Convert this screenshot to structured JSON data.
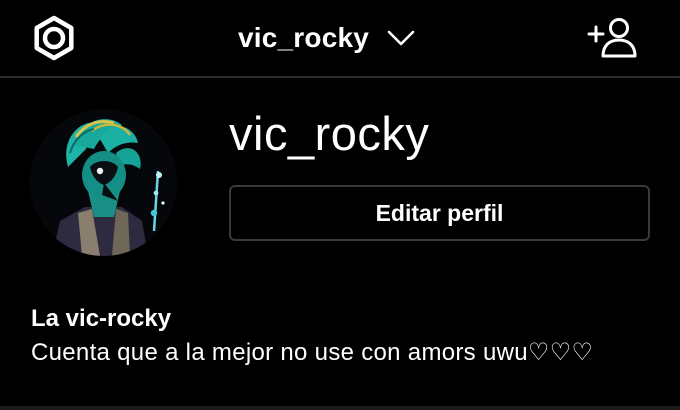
{
  "header": {
    "settings_icon": "settings-gear-icon",
    "account_name": "vic_rocky",
    "switcher_icon": "chevron-down-icon",
    "add_user_icon": "add-user-icon"
  },
  "profile": {
    "username": "vic_rocky",
    "edit_button_label": "Editar perfil",
    "display_name": "La vic-rocky",
    "bio": "Cuenta que a la mejor no use con amors uwu♡♡♡"
  },
  "colors": {
    "background": "#000000",
    "text": "#ffffff",
    "border": "#3a3a3a",
    "avatar_accent": "#1fb3a8"
  }
}
